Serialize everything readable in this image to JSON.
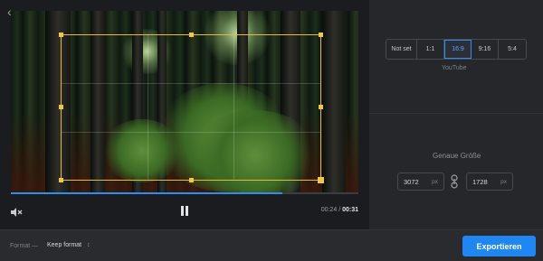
{
  "player": {
    "back_icon": "chevron-left-icon",
    "mute_icon": "speaker-muted-icon",
    "pause_icon": "pause-icon",
    "progress": 0.78,
    "current_time": "00:24",
    "separator": "/",
    "total_time": "00:31"
  },
  "aspect": {
    "options": [
      "Not set",
      "1:1",
      "16:9",
      "9:16",
      "5:4"
    ],
    "selected": "16:9",
    "hint": "YouTube"
  },
  "size": {
    "title": "Genaue Größe",
    "width": "3072",
    "height": "1728",
    "unit": "px",
    "link_icon": "link-icon"
  },
  "footer": {
    "format_label": "Format —",
    "format_value": "Keep format",
    "format_icon": "chevron-updown-icon",
    "export_label": "Exportieren"
  },
  "colors": {
    "accent": "#1f86f2",
    "crop_frame": "#e5b93a"
  }
}
